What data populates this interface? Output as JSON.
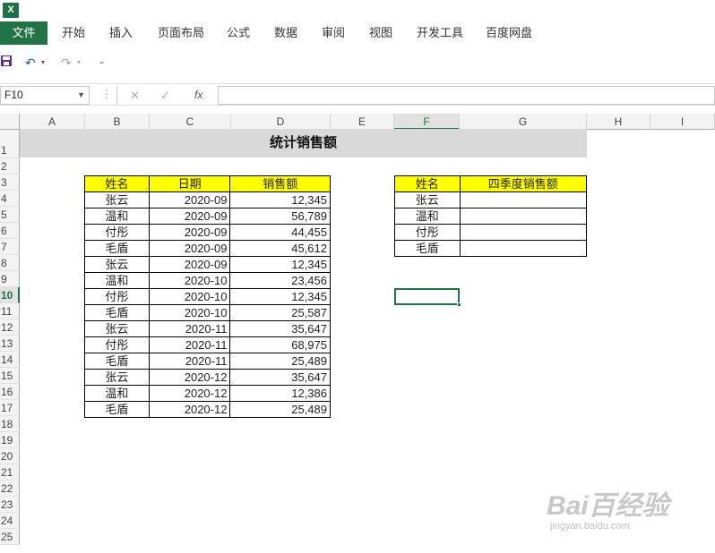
{
  "app": {
    "logo_text": "X"
  },
  "ribbon": {
    "file_tab": "文件",
    "tabs": [
      "开始",
      "插入",
      "页面布局",
      "公式",
      "数据",
      "审阅",
      "视图",
      "开发工具",
      "百度网盘"
    ]
  },
  "qat": {
    "save_icon": "save-icon",
    "undo_icon": "undo-icon",
    "redo_icon": "redo-icon",
    "customize_icon": "customize-icon"
  },
  "formula_bar": {
    "name_box": "F10",
    "content": ""
  },
  "columns": [
    "A",
    "B",
    "C",
    "D",
    "E",
    "F",
    "G",
    "H",
    "I"
  ],
  "rows": [
    "1",
    "2",
    "3",
    "4",
    "5",
    "6",
    "7",
    "8",
    "9",
    "10",
    "11",
    "12",
    "13",
    "14",
    "15",
    "16",
    "17",
    "18",
    "19",
    "20",
    "21",
    "22",
    "23",
    "24",
    "25"
  ],
  "selected_cell": "F10",
  "sheet": {
    "title": "统计销售额",
    "sales_table": {
      "headers": [
        "姓名",
        "日期",
        "销售额"
      ],
      "rows": [
        [
          "张云",
          "2020-09",
          "12,345"
        ],
        [
          "温和",
          "2020-09",
          "56,789"
        ],
        [
          "付彤",
          "2020-09",
          "44,455"
        ],
        [
          "毛盾",
          "2020-09",
          "45,612"
        ],
        [
          "张云",
          "2020-09",
          "12,345"
        ],
        [
          "温和",
          "2020-10",
          "23,456"
        ],
        [
          "付彤",
          "2020-10",
          "12,345"
        ],
        [
          "毛盾",
          "2020-10",
          "25,587"
        ],
        [
          "张云",
          "2020-11",
          "35,647"
        ],
        [
          "付彤",
          "2020-11",
          "68,975"
        ],
        [
          "毛盾",
          "2020-11",
          "25,489"
        ],
        [
          "张云",
          "2020-12",
          "35,647"
        ],
        [
          "温和",
          "2020-12",
          "12,386"
        ],
        [
          "毛盾",
          "2020-12",
          "25,489"
        ]
      ]
    },
    "summary_table": {
      "headers": [
        "姓名",
        "四季度销售额"
      ],
      "rows": [
        [
          "张云",
          ""
        ],
        [
          "温和",
          ""
        ],
        [
          "付彤",
          ""
        ],
        [
          "毛盾",
          ""
        ]
      ]
    }
  },
  "watermark": {
    "main": "Bai百经验",
    "sub": "jingyan.baidu.com"
  },
  "colors": {
    "file_tab": "#217346",
    "header_fill": "#ffff00",
    "title_fill": "#d9d9d9",
    "selection": "#217346"
  }
}
